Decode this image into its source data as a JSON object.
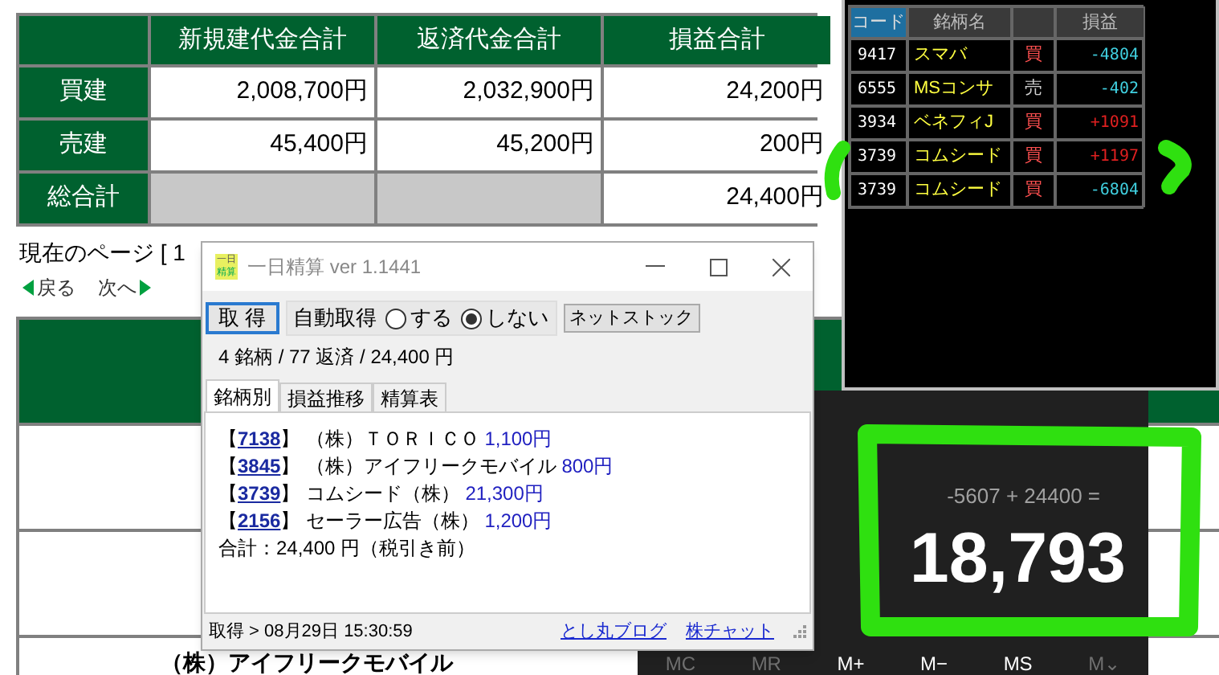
{
  "summary_table": {
    "columns": [
      "新規建代金合計",
      "返済代金合計",
      "損益合計"
    ],
    "rows": [
      {
        "label": "買建",
        "cells": [
          "2,008,700円",
          "2,032,900円",
          "24,200円"
        ]
      },
      {
        "label": "売建",
        "cells": [
          "45,400円",
          "45,200円",
          "200円"
        ]
      },
      {
        "label": "総合計",
        "cells": [
          null,
          null,
          "24,400円"
        ]
      }
    ]
  },
  "page_info": "現在のページ [ 1",
  "nav": {
    "back": "戻る",
    "next": "次へ"
  },
  "lower_heading": "（株）アイフリークモバイル",
  "ticker": {
    "columns": [
      "コード",
      "銘柄名",
      "",
      "損益"
    ],
    "rows": [
      {
        "code": "9417",
        "name": "スマバ",
        "side": "買",
        "kind": "buy",
        "pl": "-4804",
        "gain": false
      },
      {
        "code": "6555",
        "name": "MSコンサ",
        "side": "売",
        "kind": "sell",
        "pl": "-402",
        "gain": false
      },
      {
        "code": "3934",
        "name": "ベネフィJ",
        "side": "買",
        "kind": "buy",
        "pl": "+1091",
        "gain": true
      },
      {
        "code": "3739",
        "name": "コムシード",
        "side": "買",
        "kind": "buy",
        "pl": "+1197",
        "gain": true
      },
      {
        "code": "3739",
        "name": "コムシード",
        "side": "買",
        "kind": "buy",
        "pl": "-6804",
        "gain": false
      }
    ]
  },
  "calculator": {
    "expression": "-5607 + 24400 =",
    "result": "18,793",
    "memory_buttons": [
      {
        "label": "MC",
        "disabled": true
      },
      {
        "label": "MR",
        "disabled": true
      },
      {
        "label": "M+",
        "disabled": false
      },
      {
        "label": "M−",
        "disabled": false
      },
      {
        "label": "MS",
        "disabled": false
      },
      {
        "label": "M⌄",
        "disabled": true
      }
    ]
  },
  "dialog": {
    "title": "一日精算 ver 1.1441",
    "icon_text": [
      "一日",
      "精算"
    ],
    "fetch_button": "取 得",
    "auto_label": "自動取得",
    "auto_options": [
      {
        "label": "する",
        "selected": false
      },
      {
        "label": "しない",
        "selected": true
      }
    ],
    "netstock_button": "ネットストック",
    "summary": "4 銘柄 / 77 返済 / 24,400 円",
    "tabs": [
      {
        "label": "銘柄別",
        "selected": true
      },
      {
        "label": "損益推移",
        "selected": false
      },
      {
        "label": "精算表",
        "selected": false
      }
    ],
    "code_brackets": [
      "【",
      "】"
    ],
    "items": [
      {
        "code": "7138",
        "name": "（株）ＴＯＲＩＣＯ",
        "amount": "1,100円"
      },
      {
        "code": "3845",
        "name": "（株）アイフリークモバイル",
        "amount": "800円"
      },
      {
        "code": "3739",
        "name": "コムシード（株）",
        "amount": "21,300円"
      },
      {
        "code": "2156",
        "name": "セーラー広告（株）",
        "amount": "1,200円"
      }
    ],
    "total": "合計：24,400 円（税引き前）",
    "status": "取得 > 08月29日 15:30:59",
    "links": [
      "とし丸ブログ",
      "株チャット"
    ]
  }
}
